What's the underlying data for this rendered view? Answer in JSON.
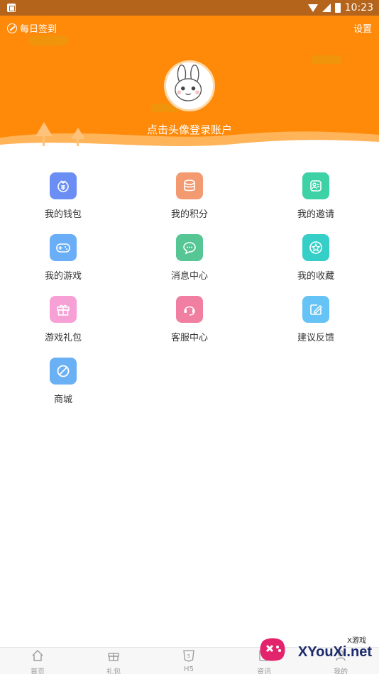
{
  "status_bar": {
    "time": "10:23"
  },
  "header": {
    "checkin_label": "每日签到",
    "settings_label": "设置",
    "login_prompt": "点击头像登录账户"
  },
  "menu": [
    {
      "label": "我的钱包",
      "icon": "wallet-icon",
      "color": "#6b8ef5"
    },
    {
      "label": "我的积分",
      "icon": "coins-icon",
      "color": "#f39a70"
    },
    {
      "label": "我的邀请",
      "icon": "invite-icon",
      "color": "#3dd1a6"
    },
    {
      "label": "我的游戏",
      "icon": "gamepad-icon",
      "color": "#6aaef7"
    },
    {
      "label": "消息中心",
      "icon": "message-icon",
      "color": "#55c694"
    },
    {
      "label": "我的收藏",
      "icon": "star-icon",
      "color": "#35cfc7"
    },
    {
      "label": "游戏礼包",
      "icon": "gift-icon",
      "color": "#f6a0d6"
    },
    {
      "label": "客服中心",
      "icon": "headset-icon",
      "color": "#f07fa2"
    },
    {
      "label": "建议反馈",
      "icon": "feedback-icon",
      "color": "#66c3f5"
    },
    {
      "label": "商城",
      "icon": "shop-icon",
      "color": "#6ab0f5"
    }
  ],
  "tabbar": {
    "home": "首页",
    "gift": "礼包",
    "h5": "H5",
    "tab4": "资讯",
    "tab5": "我的"
  },
  "watermark": {
    "brand": "XYouXi.net",
    "tag": "X游戏"
  }
}
